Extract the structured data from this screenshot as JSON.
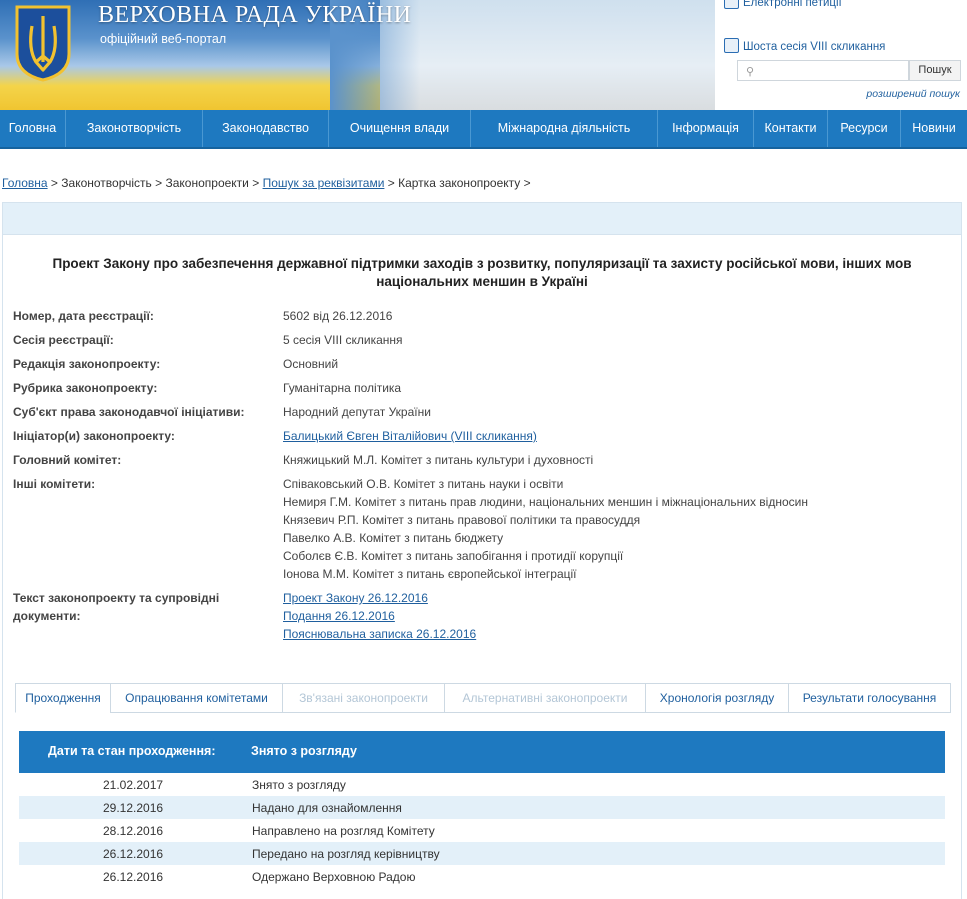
{
  "header": {
    "title": "ВЕРХОВНА РАДА УКРАЇНИ",
    "subtitle": "офіційний веб-портал",
    "petitions_link": "Електронні петиції",
    "session_link": "Шоста сесія VIII скликання",
    "search_placeholder": "",
    "search_button": "Пошук",
    "advanced_search": "розширений пошук"
  },
  "nav": {
    "items": [
      {
        "label": "Головна"
      },
      {
        "label": "Законотворчість"
      },
      {
        "label": "Законодавство"
      },
      {
        "label": "Очищення влади"
      },
      {
        "label": "Міжнародна діяльність"
      },
      {
        "label": "Інформація"
      },
      {
        "label": "Контакти"
      },
      {
        "label": "Ресурси"
      },
      {
        "label": "Новини"
      }
    ]
  },
  "breadcrumb": {
    "home": "Головна",
    "sep1": " > ",
    "lawmaking": "Законотворчість",
    "sep2": " > ",
    "bills": "Законопроекти",
    "sep3": " > ",
    "search": "Пошук за реквізитами",
    "sep4": " > ",
    "card": "Картка законопроекту",
    "sep5": " >"
  },
  "bill": {
    "title": "Проект Закону про забезпечення державної підтримки заходів з розвитку, популяризації та захисту російської мови, інших мов національних меншин в Україні",
    "fields": {
      "number_label": "Номер, дата реєстрації:",
      "number_value": "5602 від 26.12.2016",
      "session_label": "Сесія реєстрації:",
      "session_value": "5 сесія VIII скликання",
      "edition_label": "Редакція законопроекту:",
      "edition_value": "Основний",
      "rubric_label": "Рубрика законопроекту:",
      "rubric_value": "Гуманітарна політика",
      "subject_label": "Суб'єкт права законодавчої ініціативи:",
      "subject_value": "Народний депутат України",
      "initiator_label": "Ініціатор(и) законопроекту:",
      "initiator_value": "Балицький Євген Віталійович (VIII скликання)",
      "main_committee_label": "Головний комітет:",
      "main_committee_value": "Княжицький М.Л. Комітет з питань культури і духовності",
      "other_committees_label": "Інші комітети:",
      "other_committees": [
        "Співаковський О.В. Комітет з питань науки і освіти",
        "Немиря Г.М. Комітет з питань прав людини, національних меншин і міжнаціональних відносин",
        "Князевич Р.П. Комітет з питань правової політики та правосуддя",
        "Павелко А.В. Комітет з питань бюджету",
        "Соболєв Є.В. Комітет з питань запобігання і протидії корупції",
        "Іонова М.М. Комітет з питань європейської інтеграції"
      ],
      "docs_label": "Текст законопроекту та супровідні документи:",
      "docs": [
        "Проект Закону 26.12.2016",
        "Подання 26.12.2016",
        "Пояснювальна записка 26.12.2016"
      ]
    }
  },
  "tabs": [
    {
      "label": "Проходження",
      "state": "active"
    },
    {
      "label": "Опрацювання комітетами",
      "state": "normal"
    },
    {
      "label": "Зв'язані законопроекти",
      "state": "disabled"
    },
    {
      "label": "Альтернативні законопроекти",
      "state": "disabled"
    },
    {
      "label": "Хронологія розгляду",
      "state": "normal"
    },
    {
      "label": "Результати голосування",
      "state": "normal"
    }
  ],
  "passage": {
    "header_label": "Дати та стан проходження:",
    "header_status": "Знято з розгляду",
    "rows": [
      {
        "date": "21.02.2017",
        "status": "Знято з розгляду"
      },
      {
        "date": "29.12.2016",
        "status": "Надано для ознайомлення"
      },
      {
        "date": "28.12.2016",
        "status": "Направлено на розгляд Комітету"
      },
      {
        "date": "26.12.2016",
        "status": "Передано на розгляд керівництву"
      },
      {
        "date": "26.12.2016",
        "status": "Одержано Верховною Радою"
      }
    ]
  },
  "colors": {
    "nav_blue": "#1e79c0",
    "link_blue": "#1f5f9e",
    "row_alt": "#e3f0f9"
  }
}
